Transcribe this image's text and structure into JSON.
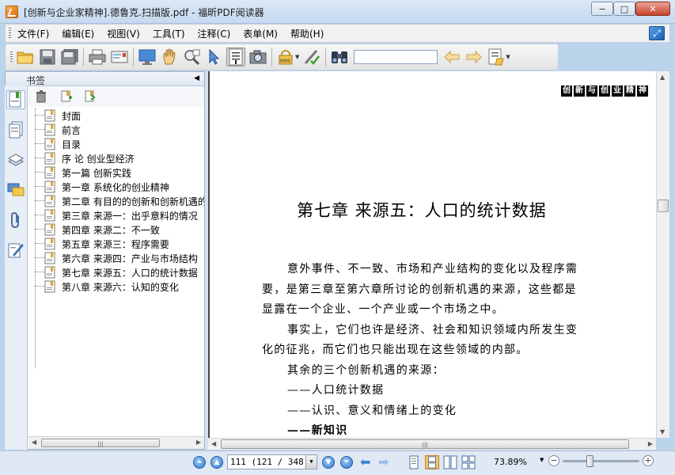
{
  "window": {
    "title": "[创新与企业家精神].德鲁克.扫描版.pdf - 福昕PDF阅读器",
    "min_label": "−",
    "max_label": "□",
    "close_label": "✕"
  },
  "menu": {
    "items": [
      "文件(F)",
      "编辑(E)",
      "视图(V)",
      "工具(T)",
      "注释(C)",
      "表单(M)",
      "帮助(H)"
    ]
  },
  "toolbar": {
    "icons": [
      "open-folder-icon",
      "save-icon",
      "save-all-icon",
      "print-icon",
      "email-icon",
      "fullscreen-icon",
      "hand-tool-icon",
      "zoom-tool-icon",
      "select-arrow-icon",
      "select-text-icon",
      "snapshot-icon",
      "rms-lock-icon",
      "sign-icon",
      "binoculars-icon",
      "find-prev-icon",
      "find-next-icon",
      "typewriter-icon"
    ],
    "search_value": ""
  },
  "panel": {
    "title": "书签",
    "bookmarks": [
      "封面",
      "前言",
      "目录",
      "序 论 创业型经济",
      "第一篇 创新实践",
      "第一章 系统化的创业精神",
      "第二章 有目的的创新和创新机遇的",
      "第三章 来源一：出乎意料的情况",
      "第四章 来源二：不一致",
      "第五章 来源三：程序需要",
      "第六章 来源四：产业与市场结构",
      "第七章 来源五：人口的统计数据",
      "第八章 来源六：认知的变化"
    ]
  },
  "document": {
    "header_chars": [
      "创",
      "新",
      "与",
      "创",
      "业",
      "精",
      "神"
    ],
    "chapter_title": "第七章    来源五：人口的统计数据",
    "lines": [
      {
        "text": "意外事件、不一致、市场和产业结构的变化以及程序需",
        "indent": true
      },
      {
        "text": "要，是第三章至第六章所讨论的创新机遇的来源，这些都是",
        "indent": false
      },
      {
        "text": "显露在一个企业、一个产业或一个市场之中。",
        "indent": false
      },
      {
        "text": "事实上，它们也许是经济、社会和知识领域内所发生变",
        "indent": true
      },
      {
        "text": "化的征兆，而它们也只能出现在这些领域的内部。",
        "indent": false
      },
      {
        "text": "其余的三个创新机遇的来源：",
        "indent": true
      },
      {
        "text": "——人口统计数据",
        "indent": true
      },
      {
        "text": "——认识、意义和情绪上的变化",
        "indent": true
      },
      {
        "text": "——新知识",
        "indent": true
      }
    ]
  },
  "status": {
    "page_value": "111 (121 / 348)",
    "zoom": "73.89%",
    "zoom_fraction": 0.34
  }
}
